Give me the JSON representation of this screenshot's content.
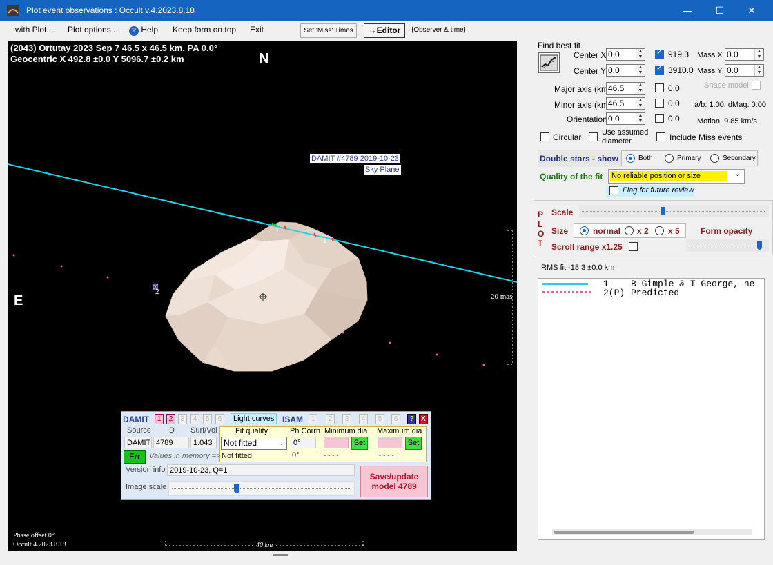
{
  "window": {
    "title": "Plot event observations : Occult v.4.2023.8.18"
  },
  "menu": {
    "with_plot": "with Plot...",
    "plot_options": "Plot options...",
    "help": "Help",
    "keep_form_on_top": "Keep form on top",
    "exit": "Exit",
    "set_miss_times": "Set 'Miss' Times",
    "editor": "→Editor",
    "observer_time": "{Observer & time}"
  },
  "plot": {
    "header_line1": "(2043) Ortutay  2023 Sep 7  46.5 x 46.5 km, PA 0.0°",
    "header_line2": "Geocentric  X  492.8 ±0.0  Y 5096.7 ±0.2 km",
    "north": "N",
    "east": "E",
    "damit_tag": "DAMIT #4789 2019-10-23",
    "sky_plane": "Sky Plane",
    "scale_mas": "20 mas",
    "scale_km": "40 km",
    "chord_label_1a": "1",
    "chord_label_1b": "1",
    "chord_label_2": "2",
    "phase_offset": "Phase offset 0°",
    "version": "Occult 4.2023.8.18"
  },
  "damit_panel": {
    "title": "DAMIT",
    "nums": [
      "1",
      "2",
      "3",
      "4",
      "5",
      "6"
    ],
    "light_curves": "Light curves",
    "isam": "ISAM",
    "isam_nums": [
      "1",
      "2",
      "3",
      "4",
      "5",
      "6"
    ],
    "help_btn": "?",
    "close_btn": "X",
    "col_source": "Source",
    "col_id": "ID",
    "col_surfvol": "Surf/Vol",
    "col_fit_quality": "Fit quality",
    "col_ph_corr": "Ph Corrn",
    "col_min_dia": "Minimum dia",
    "col_max_dia": "Maximum dia",
    "source": "DAMIT",
    "id": "4789",
    "surfvol": "1.043",
    "fit_quality_select": "Not fitted",
    "fit_quality_mem": "Not fitted",
    "ph_corr": "0°",
    "ph_corr_mem": "0°",
    "set1": "Set",
    "set2": "Set",
    "min_dash": "- - - -",
    "max_dash": "- - - -",
    "err_btn": "Err",
    "values_in_memory": "Values in memory =>",
    "version_info_label": "Version info",
    "version_info": "2019-10-23, Q=1",
    "image_scale_label": "Image scale",
    "save_update_1": "Save/update",
    "save_update_2": "model 4789"
  },
  "fit": {
    "find_best_fit": "Find best fit",
    "center_x_label": "Center X",
    "center_x": "0.0",
    "center_y_label": "Center Y",
    "center_y": "0.0",
    "x_fixed": "919.3",
    "y_fixed": "3910.0",
    "mass_x_label": "Mass X",
    "mass_x": "0.0",
    "mass_y_label": "Mass Y",
    "mass_y": "0.0",
    "major_axis_label": "Major axis (km)",
    "major_axis": "46.5",
    "major_chk": "0.0",
    "minor_axis_label": "Minor axis (km)",
    "minor_axis": "46.5",
    "minor_chk": "0.0",
    "orientation_label": "Orientation",
    "orientation": "0.0",
    "orient_chk": "0.0",
    "shape_model": "Shape model",
    "ab_dmag": "a/b: 1.00, dMag: 0.00",
    "motion": "Motion: 9.85 km/s",
    "circular": "Circular",
    "use_assumed_1": "Use assumed",
    "use_assumed_2": "diameter",
    "include_miss": "Include Miss events",
    "double_stars": "Double stars - show",
    "both": "Both",
    "primary": "Primary",
    "secondary": "Secondary",
    "quality_label": "Quality of the fit",
    "quality_value": "No reliable position or size",
    "flag_review": "Flag for future review"
  },
  "plot_ctrl": {
    "vertical": [
      "P",
      "L",
      "O",
      "T"
    ],
    "scale": "Scale",
    "size": "Size",
    "normal": "normal",
    "x2": "x 2",
    "x5": "x 5",
    "form_opacity": "Form opacity",
    "scroll_range": "Scroll range x1.25",
    "rms_fit": "RMS fit -18.3 ±0.0 km"
  },
  "legend": {
    "rows": [
      {
        "num": "1",
        "text": "B Gimple & T George, ne"
      },
      {
        "num": "2(P)",
        "text": "Predicted"
      }
    ]
  },
  "colors": {
    "titlebar": "#1565c0",
    "chord": "#22d3e6",
    "asteroid": "#e8d8cc",
    "predicted": "#ff4fa6",
    "quality": "#fff200"
  }
}
